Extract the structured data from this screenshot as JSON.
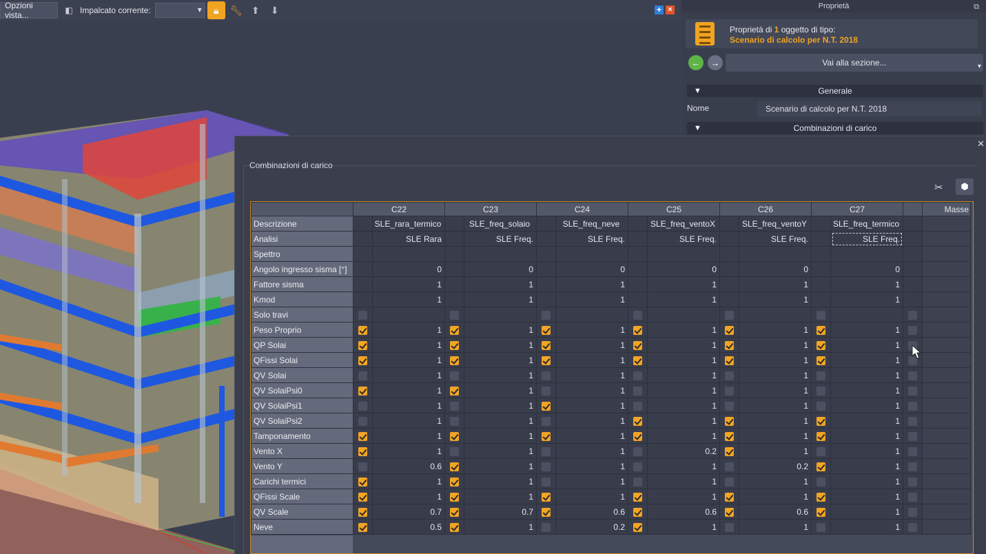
{
  "toolbar": {
    "view_options": "Opzioni vista...",
    "current_level_label": "Impalcato corrente:",
    "current_level_value": "",
    "icons": [
      "view-icon",
      "lock-icon",
      "wrench-icon",
      "arrow-up-icon",
      "arrow-down-icon",
      "add-icon",
      "close-icon"
    ]
  },
  "properties": {
    "title": "Proprietà",
    "info_prefix": "Proprietà di",
    "info_count": "1",
    "info_suffix": "oggetto di tipo:",
    "object_type": "Scenario di calcolo per N.T. 2018",
    "goto_section": "Vai alla sezione...",
    "section_general": "Generale",
    "name_label": "Nome",
    "name_value": "Scenario di calcolo per N.T. 2018",
    "section_combinations": "Combinazioni di carico"
  },
  "dialog": {
    "title": "Combinazioni di carico",
    "accent_color": "#f2a524"
  },
  "grid": {
    "columns": [
      "C22",
      "C23",
      "C24",
      "C25",
      "C26",
      "C27"
    ],
    "extra_column": "Masse",
    "rows": [
      {
        "label": "Descrizione",
        "values": [
          "SLE_rara_termico",
          "SLE_freq_solaio",
          "SLE_freq_neve",
          "SLE_freq_ventoX",
          "SLE_freq_ventoY",
          "SLE_freq_termico"
        ],
        "checks": null
      },
      {
        "label": "Analisi",
        "values": [
          "SLE Rara",
          "SLE Freq.",
          "SLE Freq.",
          "SLE Freq.",
          "SLE Freq.",
          "SLE Freq."
        ],
        "checks": null
      },
      {
        "label": "Spettro",
        "values": [
          "",
          "",
          "",
          "",
          "",
          ""
        ],
        "checks": null
      },
      {
        "label": "Angolo ingresso sisma [°]",
        "values": [
          "0",
          "0",
          "0",
          "0",
          "0",
          "0"
        ],
        "checks": null
      },
      {
        "label": "Fattore sisma",
        "values": [
          "1",
          "1",
          "1",
          "1",
          "1",
          "1"
        ],
        "checks": null
      },
      {
        "label": "Kmod",
        "values": [
          "1",
          "1",
          "1",
          "1",
          "1",
          "1"
        ],
        "checks": null
      },
      {
        "label": "Solo travi",
        "values": [
          "",
          "",
          "",
          "",
          "",
          ""
        ],
        "checks": [
          false,
          false,
          false,
          false,
          false,
          false
        ]
      },
      {
        "label": "Peso Proprio",
        "values": [
          "1",
          "1",
          "1",
          "1",
          "1",
          "1"
        ],
        "checks": [
          true,
          true,
          true,
          true,
          true,
          true
        ]
      },
      {
        "label": "QP Solai",
        "values": [
          "1",
          "1",
          "1",
          "1",
          "1",
          "1"
        ],
        "checks": [
          true,
          true,
          true,
          true,
          true,
          true
        ]
      },
      {
        "label": "QFissi Solai",
        "values": [
          "1",
          "1",
          "1",
          "1",
          "1",
          "1"
        ],
        "checks": [
          true,
          true,
          true,
          true,
          true,
          true
        ]
      },
      {
        "label": "QV Solai",
        "values": [
          "1",
          "1",
          "1",
          "1",
          "1",
          "1"
        ],
        "checks": [
          false,
          false,
          false,
          false,
          false,
          false
        ]
      },
      {
        "label": "QV SolaiPsi0",
        "values": [
          "1",
          "1",
          "1",
          "1",
          "1",
          "1"
        ],
        "checks": [
          true,
          true,
          false,
          false,
          false,
          false
        ]
      },
      {
        "label": "QV SolaiPsi1",
        "values": [
          "1",
          "1",
          "1",
          "1",
          "1",
          "1"
        ],
        "checks": [
          false,
          false,
          true,
          false,
          false,
          false
        ]
      },
      {
        "label": "QV SolaiPsi2",
        "values": [
          "1",
          "1",
          "1",
          "1",
          "1",
          "1"
        ],
        "checks": [
          false,
          false,
          false,
          true,
          true,
          true
        ]
      },
      {
        "label": "Tamponamento",
        "values": [
          "1",
          "1",
          "1",
          "1",
          "1",
          "1"
        ],
        "checks": [
          true,
          true,
          true,
          true,
          true,
          true
        ]
      },
      {
        "label": "Vento X",
        "values": [
          "1",
          "1",
          "1",
          "0.2",
          "1",
          "1"
        ],
        "checks": [
          true,
          false,
          false,
          false,
          true,
          false
        ]
      },
      {
        "label": "Vento Y",
        "values": [
          "0.6",
          "1",
          "1",
          "1",
          "0.2",
          "1"
        ],
        "checks": [
          false,
          true,
          false,
          false,
          false,
          true
        ]
      },
      {
        "label": "Carichi termici",
        "values": [
          "1",
          "1",
          "1",
          "1",
          "1",
          "1"
        ],
        "checks": [
          true,
          true,
          false,
          false,
          false,
          false
        ]
      },
      {
        "label": "QFissi Scale",
        "values": [
          "1",
          "1",
          "1",
          "1",
          "1",
          "1"
        ],
        "checks": [
          true,
          true,
          true,
          true,
          true,
          true
        ]
      },
      {
        "label": "QV Scale",
        "values": [
          "0.7",
          "0.7",
          "0.6",
          "0.6",
          "0.6",
          "1"
        ],
        "checks": [
          true,
          true,
          true,
          true,
          true,
          true
        ]
      },
      {
        "label": "Neve",
        "values": [
          "0.5",
          "1",
          "0.2",
          "1",
          "1",
          "1"
        ],
        "checks": [
          true,
          true,
          false,
          true,
          false,
          false
        ]
      }
    ]
  }
}
